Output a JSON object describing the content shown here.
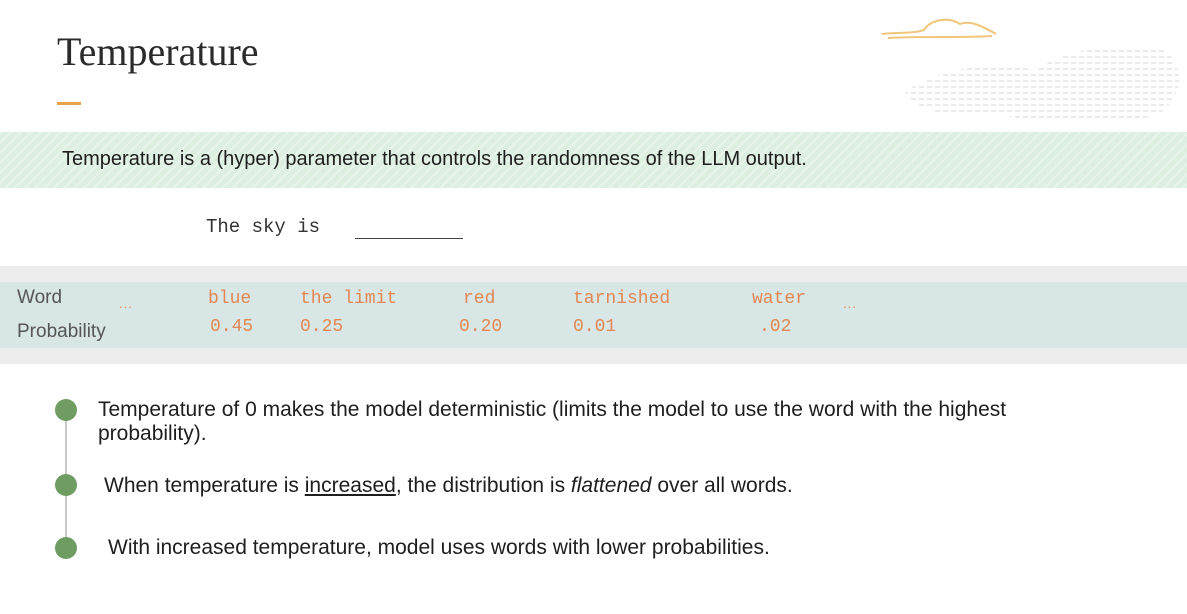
{
  "title": "Temperature",
  "intro": "Temperature is a (hyper) parameter that controls the randomness of the LLM output.",
  "prompt": "The sky is",
  "table": {
    "word_label": "Word",
    "prob_label": "Probability",
    "ellipsis": "...",
    "words": [
      "blue",
      "the limit",
      "red",
      "tarnished",
      "water"
    ],
    "probs": [
      "0.45",
      "0.25",
      "0.20",
      "0.01",
      ".02"
    ],
    "trailing_ellipsis": "..."
  },
  "bullets": {
    "b1_line1": "Temperature of 0 makes the model deterministic (limits the model to use the word with the highest",
    "b1_line2": "probability).",
    "b2_pre": "When temperature is ",
    "b2_u": "increased",
    "b2_mid": ", the distribution is ",
    "b2_i": "flattened",
    "b2_post": " over all words.",
    "b3": "With increased temperature, model uses words with lower probabilities."
  },
  "colors": {
    "accent": "#e8a24b",
    "band": "#dcefe1",
    "word_color": "#e28753",
    "bullet_dot": "#6f9c62"
  }
}
